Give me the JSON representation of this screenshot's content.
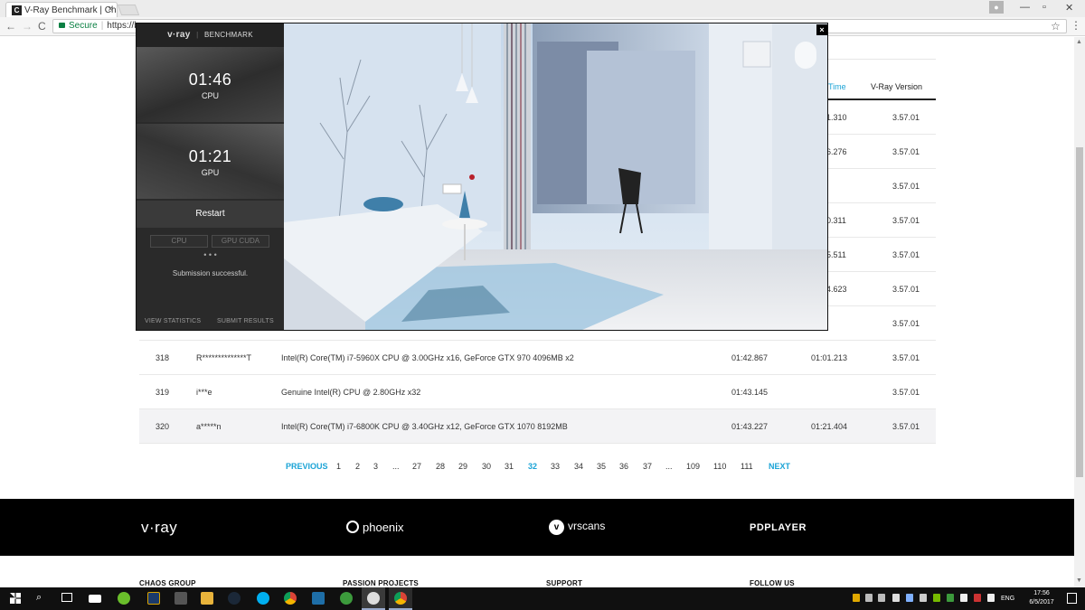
{
  "browser": {
    "tab_title": "V-Ray Benchmark | Chao",
    "tab_close": "×",
    "url_secure": "Secure",
    "url_text": "https://be",
    "nav": {
      "back": "←",
      "forward": "→",
      "reload": "C"
    },
    "window": {
      "minimize": "—",
      "restore": "▫",
      "close": "✕"
    }
  },
  "table": {
    "headers": {
      "time": "Time",
      "vray_version": "V-Ray Version"
    },
    "partial_rows": [
      {
        "time_fragment": "1.310",
        "version": "3.57.01"
      },
      {
        "time_fragment": "6.276",
        "version": "3.57.01"
      },
      {
        "time_fragment": "",
        "version": "3.57.01"
      },
      {
        "time_fragment": "0.311",
        "version": "3.57.01"
      },
      {
        "time_fragment": "5.511",
        "version": "3.57.01"
      },
      {
        "time_fragment": "4.623",
        "version": "3.57.01"
      },
      {
        "time_fragment": "",
        "version": "3.57.01"
      }
    ],
    "rows": [
      {
        "rank": "318",
        "user": "R**************T",
        "hardware": "Intel(R) Core(TM) i7-5960X CPU @ 3.00GHz x16, GeForce GTX 970 4096MB x2",
        "cpu_time": "01:42.867",
        "gpu_time": "01:01.213",
        "version": "3.57.01"
      },
      {
        "rank": "319",
        "user": "i***e",
        "hardware": "Genuine Intel(R) CPU @ 2.80GHz x32",
        "cpu_time": "01:43.145",
        "gpu_time": "",
        "version": "3.57.01"
      },
      {
        "rank": "320",
        "user": "a*****n",
        "hardware": "Intel(R) Core(TM) i7-6800K CPU @ 3.40GHz x12, GeForce GTX 1070 8192MB",
        "cpu_time": "01:43.227",
        "gpu_time": "01:21.404",
        "version": "3.57.01"
      }
    ]
  },
  "pagination": {
    "previous": "PREVIOUS",
    "next": "NEXT",
    "items": [
      "1",
      "2",
      "3",
      "...",
      "27",
      "28",
      "29",
      "30",
      "31",
      "32",
      "33",
      "34",
      "35",
      "36",
      "37",
      "...",
      "109",
      "110",
      "111"
    ],
    "current": "32"
  },
  "footer": {
    "brands": [
      "v·ray",
      "phoenix",
      "vrscans",
      "PDPLAYER"
    ],
    "columns": [
      "CHAOS GROUP",
      "PASSION PROJECTS",
      "SUPPORT",
      "FOLLOW US"
    ]
  },
  "modal": {
    "header_logo": "v·ray",
    "header_label": "BENCHMARK",
    "cpu_time": "01:46",
    "cpu_label": "CPU",
    "gpu_time": "01:21",
    "gpu_label": "GPU",
    "restart": "Restart",
    "mode_cpu": "CPU",
    "mode_gpu": "GPU CUDA",
    "dots": "• • •",
    "status": "Submission successful.",
    "view_statistics": "VIEW STATISTICS",
    "submit_results": "SUBMIT RESULTS",
    "close": "×"
  },
  "taskbar": {
    "language": "ENG",
    "time": "17:56",
    "date": "6/5/2017"
  }
}
